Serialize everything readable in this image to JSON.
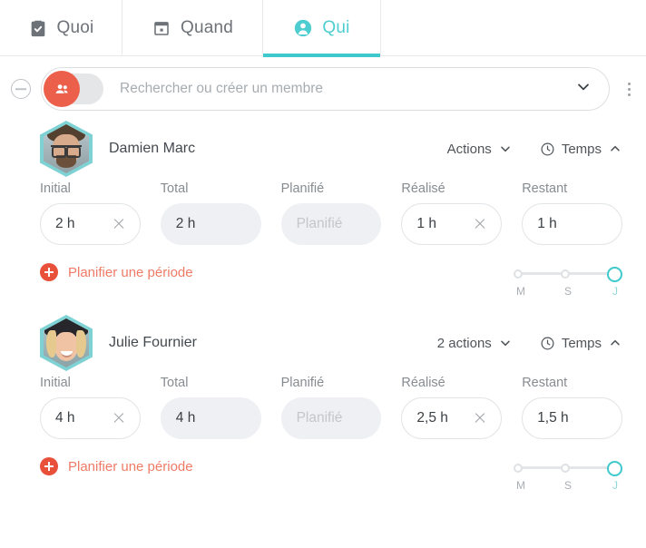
{
  "tabs": [
    {
      "label": "Quoi",
      "icon": "clipboard-check-icon",
      "active": false
    },
    {
      "label": "Quand",
      "icon": "calendar-icon",
      "active": false
    },
    {
      "label": "Qui",
      "icon": "user-icon",
      "active": true
    }
  ],
  "search": {
    "placeholder": "Rechercher ou créer un membre",
    "value": "",
    "collapse_icon": "minus-circle-icon",
    "toggle_icon": "people-icon",
    "toggle_on": true,
    "dropdown_icon": "chevron-down-icon",
    "overflow_icon": "kebab-menu-icon"
  },
  "colors": {
    "accent_teal": "#3fc9cc",
    "accent_coral": "#e8503a",
    "toggle_coral": "#ec5f4a",
    "text_dark": "#44494e",
    "text_muted": "#878c91",
    "field_filled_bg": "#eef0f3"
  },
  "field_labels": {
    "initial": "Initial",
    "total": "Total",
    "planifie": "Planifié",
    "realise": "Réalisé",
    "restant": "Restant"
  },
  "plan_link_label": "Planifier une période",
  "temps_label": "Temps",
  "slider": {
    "stops": [
      "M",
      "S",
      "J"
    ],
    "selected_index": 2
  },
  "members": [
    {
      "name": "Damien Marc",
      "actions_label": "Actions",
      "temps_label": "Temps",
      "avatar": "avatar-damien-marc",
      "fields": {
        "initial": {
          "value": "2 h",
          "placeholder": "",
          "clearable": true,
          "filled": false
        },
        "total": {
          "value": "2 h",
          "placeholder": "",
          "clearable": false,
          "filled": true
        },
        "planifie": {
          "value": "",
          "placeholder": "Planifié",
          "clearable": false,
          "filled": true
        },
        "realise": {
          "value": "1 h",
          "placeholder": "",
          "clearable": true,
          "filled": false
        },
        "restant": {
          "value": "1 h",
          "placeholder": "",
          "clearable": false,
          "filled": false
        }
      }
    },
    {
      "name": "Julie Fournier",
      "actions_label": "2 actions",
      "temps_label": "Temps",
      "avatar": "avatar-julie-fournier",
      "fields": {
        "initial": {
          "value": "4 h",
          "placeholder": "",
          "clearable": true,
          "filled": false
        },
        "total": {
          "value": "4 h",
          "placeholder": "",
          "clearable": false,
          "filled": true
        },
        "planifie": {
          "value": "",
          "placeholder": "Planifié",
          "clearable": false,
          "filled": true
        },
        "realise": {
          "value": "2,5 h",
          "placeholder": "",
          "clearable": true,
          "filled": false
        },
        "restant": {
          "value": "1,5 h",
          "placeholder": "",
          "clearable": false,
          "filled": false
        }
      }
    }
  ]
}
